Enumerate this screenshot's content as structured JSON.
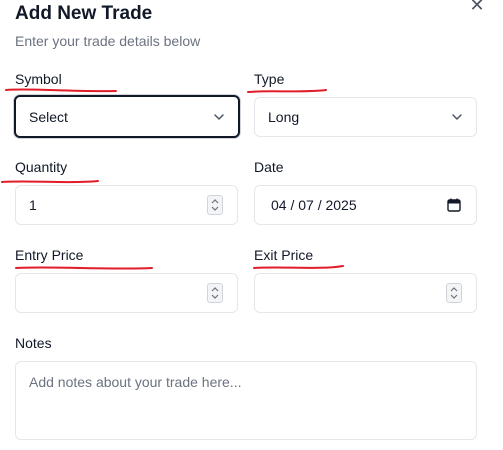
{
  "dialog": {
    "title": "Add New Trade",
    "subtitle": "Enter your trade details below",
    "close_icon": "close-icon"
  },
  "fields": {
    "symbol": {
      "label": "Symbol",
      "value": "Select"
    },
    "type": {
      "label": "Type",
      "value": "Long"
    },
    "quantity": {
      "label": "Quantity",
      "value": "1"
    },
    "date": {
      "label": "Date",
      "value": "04 / 07 / 2025"
    },
    "entry_price": {
      "label": "Entry Price",
      "value": ""
    },
    "exit_price": {
      "label": "Exit Price",
      "value": ""
    },
    "notes": {
      "label": "Notes",
      "placeholder": "Add notes about your trade here..."
    }
  },
  "colors": {
    "annotation": "#e11d2a",
    "border": "#e5e7eb",
    "muted": "#6b7280"
  }
}
